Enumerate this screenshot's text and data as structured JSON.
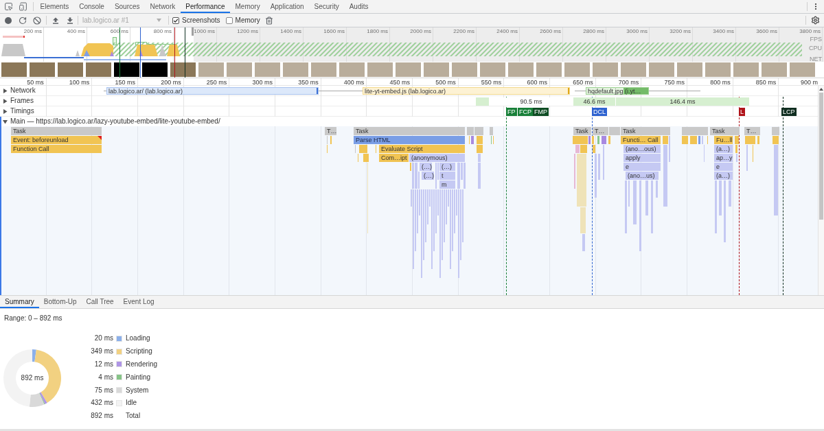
{
  "tabs": [
    {
      "label": "Elements",
      "selected": false
    },
    {
      "label": "Console",
      "selected": false
    },
    {
      "label": "Sources",
      "selected": false
    },
    {
      "label": "Network",
      "selected": false
    },
    {
      "label": "Performance",
      "selected": true
    },
    {
      "label": "Memory",
      "selected": false
    },
    {
      "label": "Application",
      "selected": false
    },
    {
      "label": "Security",
      "selected": false
    },
    {
      "label": "Audits",
      "selected": false
    }
  ],
  "toolbar": {
    "profile_select": {
      "value": "lab.logico.ar #1",
      "disabled": true
    },
    "options": [
      {
        "label": "Screenshots",
        "checked": true
      },
      {
        "label": "Memory",
        "checked": false
      }
    ]
  },
  "overview": {
    "ticks": [
      "200 ms",
      "400 ms",
      "600 ms",
      "800 ms",
      "1000 ms",
      "1200 ms",
      "1400 ms",
      "1600 ms",
      "1800 ms",
      "2000 ms",
      "2200 ms",
      "2400 ms",
      "2600 ms",
      "2800 ms",
      "3000 ms",
      "3200 ms",
      "3400 ms",
      "3600 ms",
      "3800 ms"
    ],
    "lanes": [
      "FPS",
      "CPU",
      "NET"
    ],
    "filmstrip": [
      {
        "kind": "page"
      },
      {
        "kind": "page"
      },
      {
        "kind": "page"
      },
      {
        "kind": "page"
      },
      {
        "kind": "blank"
      },
      {
        "kind": "blank"
      },
      {
        "kind": "page"
      },
      {
        "kind": "page"
      },
      {
        "kind": "page"
      },
      {
        "kind": "page"
      },
      {
        "kind": "page"
      },
      {
        "kind": "page"
      },
      {
        "kind": "page"
      },
      {
        "kind": "page"
      },
      {
        "kind": "page"
      },
      {
        "kind": "page"
      },
      {
        "kind": "page"
      },
      {
        "kind": "page"
      },
      {
        "kind": "page"
      },
      {
        "kind": "page"
      },
      {
        "kind": "page"
      },
      {
        "kind": "page"
      },
      {
        "kind": "page"
      },
      {
        "kind": "page"
      },
      {
        "kind": "page"
      },
      {
        "kind": "page"
      },
      {
        "kind": "page"
      },
      {
        "kind": "page"
      },
      {
        "kind": "page"
      }
    ]
  },
  "timeline": {
    "ticks": [
      "50 ms",
      "100 ms",
      "150 ms",
      "200 ms",
      "250 ms",
      "300 ms",
      "350 ms",
      "400 ms",
      "450 ms",
      "500 ms",
      "550 ms",
      "600 ms",
      "650 ms",
      "700 ms",
      "750 ms",
      "800 ms",
      "850 ms",
      "900 m"
    ],
    "tracks": [
      {
        "name": "Network",
        "expanded": false
      },
      {
        "name": "Frames",
        "expanded": false
      },
      {
        "name": "Timings",
        "expanded": false
      },
      {
        "name": "Main — https://lab.logico.ar/lazy-youtube-embed/lite-youtube-embed/",
        "expanded": true
      }
    ],
    "network_requests": [
      {
        "label": "lab.logico.ar/ (lab.logico.ar)",
        "kind": "document"
      },
      {
        "label": "lite-yt-embed.js (lab.logico.ar)",
        "kind": "script"
      },
      {
        "label": "hqdefault.jpg (i.yt…",
        "kind": "image"
      }
    ],
    "frames": [
      {
        "kind": "drawn"
      },
      {
        "label": "90.5 ms",
        "kind": "idle"
      },
      {
        "label": "46.6 ms",
        "kind": "drawn"
      },
      {
        "label": "146.4 ms",
        "kind": "drawn"
      }
    ],
    "timings": [
      {
        "label": "FP",
        "color": "#198039"
      },
      {
        "label": "FCP",
        "color": "#198039"
      },
      {
        "label": "FMP",
        "color": "#0f4d24"
      },
      {
        "label": "DCL",
        "color": "#2d62d0"
      },
      {
        "label": "L",
        "color": "#b0131a"
      },
      {
        "label": "LCP",
        "color": "#0f2e20"
      }
    ],
    "main_events": [
      {
        "label": "Task",
        "kind": "task",
        "warning": false
      },
      {
        "label": "Event: beforeunload",
        "kind": "scripting",
        "warning": true
      },
      {
        "label": "Function Call",
        "kind": "scripting",
        "warning": false
      },
      {
        "label": "T…",
        "kind": "task",
        "warning": false
      },
      {
        "label": "Task",
        "kind": "task",
        "warning": false
      },
      {
        "label": "Parse HTML",
        "kind": "loading",
        "warning": false
      },
      {
        "label": "Evaluate Script",
        "kind": "scripting",
        "warning": false
      },
      {
        "label": "Com…ipt",
        "kind": "scripting",
        "warning": false
      },
      {
        "label": "(anonymous)",
        "kind": "js",
        "warning": false
      },
      {
        "label": "(…)",
        "kind": "js",
        "warning": false
      },
      {
        "label": "(…)",
        "kind": "js",
        "warning": false
      },
      {
        "label": "(…)",
        "kind": "js",
        "warning": false
      },
      {
        "label": "t",
        "kind": "js",
        "warning": false
      },
      {
        "label": "m",
        "kind": "js",
        "warning": false
      },
      {
        "label": "Task",
        "kind": "task",
        "warning": false
      },
      {
        "label": "T…",
        "kind": "task",
        "warning": false
      },
      {
        "label": "Task",
        "kind": "task",
        "warning": false
      },
      {
        "label": "Functi… Call",
        "kind": "scripting",
        "warning": false
      },
      {
        "label": "(ano…ous)",
        "kind": "js",
        "warning": false
      },
      {
        "label": "apply",
        "kind": "js",
        "warning": false
      },
      {
        "label": "e",
        "kind": "js",
        "warning": false
      },
      {
        "label": "(ano…us)",
        "kind": "js",
        "warning": false
      },
      {
        "label": "Task",
        "kind": "task",
        "warning": false
      },
      {
        "label": "Fu…ll",
        "kind": "scripting",
        "warning": false
      },
      {
        "label": "(a…)",
        "kind": "js",
        "warning": false
      },
      {
        "label": "ap…y",
        "kind": "js",
        "warning": false
      },
      {
        "label": "e",
        "kind": "js",
        "warning": false
      },
      {
        "label": "(a…)",
        "kind": "js",
        "warning": false
      },
      {
        "label": "T…",
        "kind": "task",
        "warning": false
      }
    ]
  },
  "details": {
    "tabs": [
      {
        "label": "Summary",
        "selected": true
      },
      {
        "label": "Bottom-Up",
        "selected": false
      },
      {
        "label": "Call Tree",
        "selected": false
      },
      {
        "label": "Event Log",
        "selected": false
      }
    ],
    "range": "Range: 0 – 892 ms",
    "summary": {
      "center_label": "892 ms",
      "chart_data": {
        "type": "donut",
        "categories": [
          "Loading",
          "Scripting",
          "Rendering",
          "Painting",
          "System",
          "Idle"
        ],
        "values": [
          2.24,
          39.13,
          1.35,
          0.45,
          8.41,
          48.42
        ]
      },
      "legend": [
        {
          "value": "20 ms",
          "color": "#8cb0ea"
        },
        {
          "value": "349 ms",
          "color": "#f2d181"
        },
        {
          "value": "12 ms",
          "color": "#af95e6"
        },
        {
          "value": "4 ms",
          "color": "#86c487"
        },
        {
          "value": "75 ms",
          "color": "#d9d9d9"
        },
        {
          "value": "432 ms",
          "color": "#f3f3f3"
        }
      ],
      "total": {
        "value": "892 ms",
        "label": "Total"
      }
    }
  }
}
